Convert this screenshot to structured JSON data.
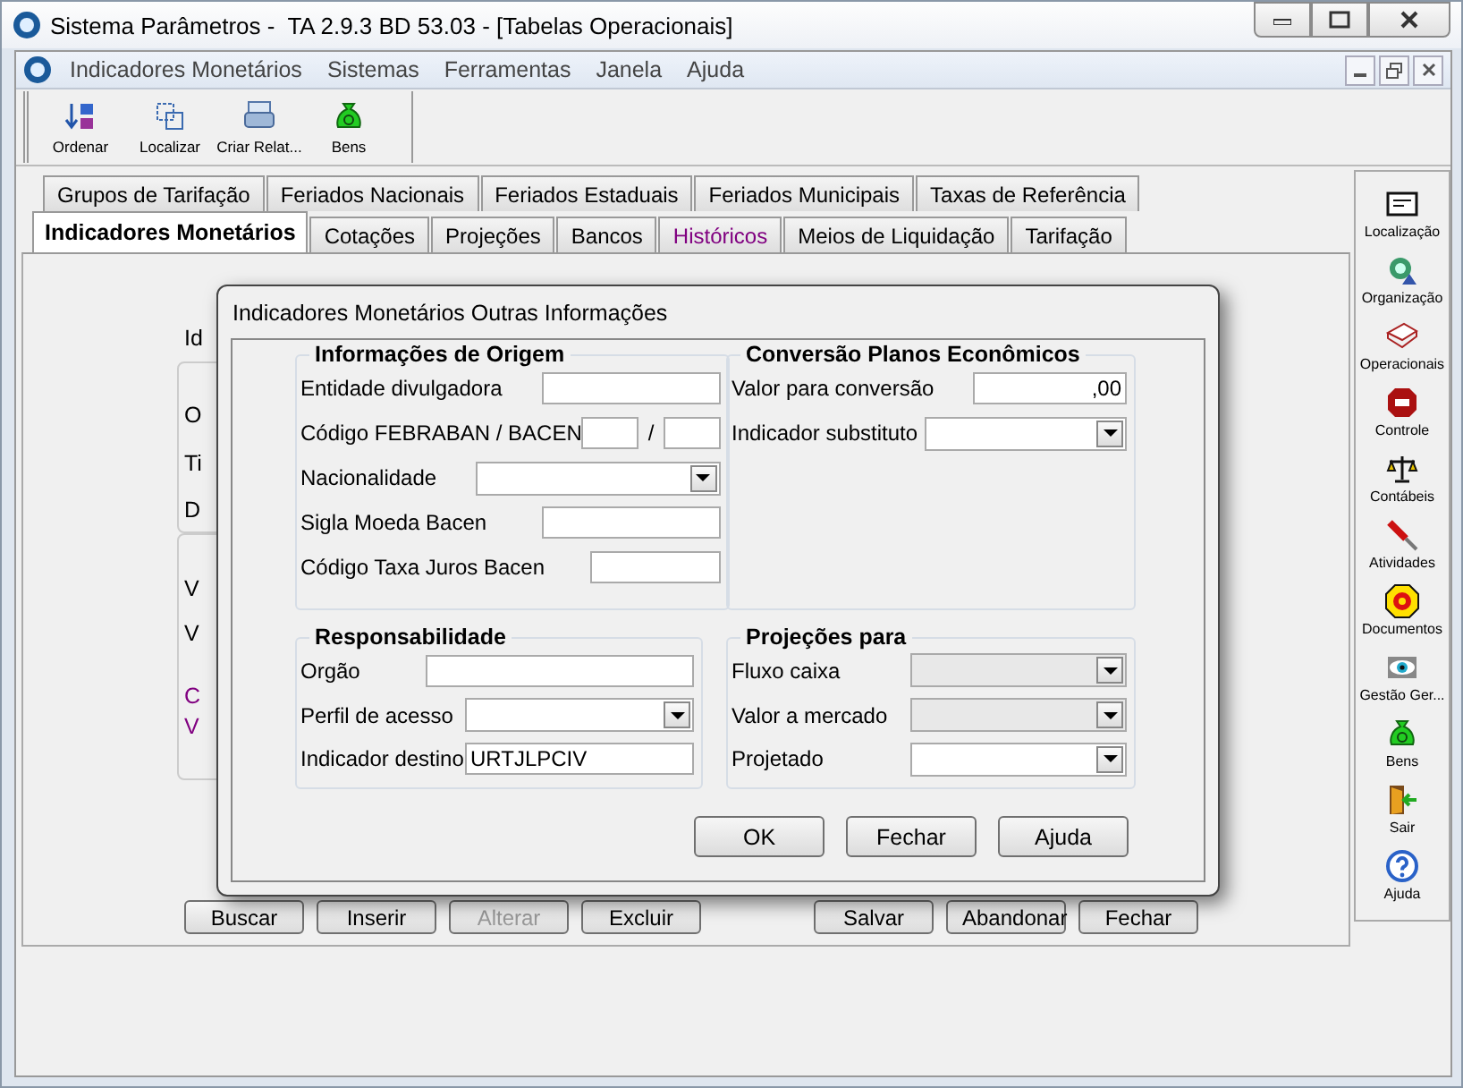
{
  "window": {
    "title": "Sistema Parâmetros -  TA 2.9.3 BD 53.03 - [Tabelas Operacionais]"
  },
  "menu": [
    "Indicadores Monetários",
    "Sistemas",
    "Ferramentas",
    "Janela",
    "Ajuda"
  ],
  "toolbar": [
    {
      "label": "Ordenar",
      "kind": "sort"
    },
    {
      "label": "Localizar",
      "kind": "find"
    },
    {
      "label": "Criar Relat...",
      "kind": "report"
    },
    {
      "label": "Bens",
      "kind": "money"
    }
  ],
  "tabs_row_1": [
    {
      "label": "Grupos de Tarifação",
      "selected": false
    },
    {
      "label": "Feriados Nacionais",
      "selected": false
    },
    {
      "label": "Feriados Estaduais",
      "selected": false
    },
    {
      "label": "Feriados Municipais",
      "selected": false
    },
    {
      "label": "Taxas de Referência",
      "selected": false
    }
  ],
  "tabs_row_2": [
    {
      "label": "Indicadores Monetários",
      "selected": true,
      "color": "#000000"
    },
    {
      "label": "Cotações",
      "selected": false,
      "color": "#000000"
    },
    {
      "label": "Projeções",
      "selected": false,
      "color": "#000000"
    },
    {
      "label": "Bancos",
      "selected": false,
      "color": "#000000"
    },
    {
      "label": "Históricos",
      "selected": false,
      "color": "#800080"
    },
    {
      "label": "Meios de Liquidação",
      "selected": false,
      "color": "#000000"
    },
    {
      "label": "Tarifação",
      "selected": false,
      "color": "#000000"
    }
  ],
  "background_labels": [
    {
      "text": "Id",
      "color": "#000000"
    },
    {
      "text": "O",
      "color": "#000000"
    },
    {
      "text": "Ti",
      "color": "#000000"
    },
    {
      "text": "D",
      "color": "#000000"
    },
    {
      "text": "V",
      "color": "#000000"
    },
    {
      "text": "V",
      "color": "#000000"
    },
    {
      "text": "C",
      "color": "#800080"
    },
    {
      "text": "V",
      "color": "#800080"
    }
  ],
  "background_buttons": [
    {
      "label": "Buscar",
      "disabled": false
    },
    {
      "label": "Inserir",
      "disabled": false
    },
    {
      "label": "Alterar",
      "disabled": true
    },
    {
      "label": "Excluir",
      "disabled": false
    },
    {
      "label": "Salvar",
      "disabled": false
    },
    {
      "label": "Abandonar",
      "disabled": false
    },
    {
      "label": "Fechar",
      "disabled": false
    }
  ],
  "dialog": {
    "title": "Indicadores Monetários Outras Informações",
    "groups": [
      {
        "title": "Informações de Origem",
        "fields": [
          {
            "label": "Entidade divulgadora",
            "kind": "text",
            "disabled": false
          },
          {
            "label": "Código FEBRABAN / BACEN",
            "kind": "pair",
            "separator": "/",
            "disabled": false
          },
          {
            "label": "Nacionalidade",
            "kind": "combo",
            "disabled": false
          },
          {
            "label": "Sigla Moeda Bacen",
            "kind": "text",
            "disabled": false
          },
          {
            "label": "Código Taxa Juros Bacen",
            "kind": "text",
            "disabled": false
          }
        ]
      },
      {
        "title": "Conversão Planos Econômicos",
        "fields": [
          {
            "label": "Valor para conversão",
            "kind": "number",
            "value": ",00",
            "disabled": false
          },
          {
            "label": "Indicador substituto",
            "kind": "combo",
            "disabled": false
          }
        ]
      },
      {
        "title": "Responsabilidade",
        "fields": [
          {
            "label": "Orgão",
            "kind": "text",
            "disabled": false
          },
          {
            "label": "Perfil de acesso",
            "kind": "combo",
            "disabled": false
          },
          {
            "label": "Indicador destino",
            "kind": "text",
            "value": "URTJLPCIV",
            "disabled": false
          }
        ]
      },
      {
        "title": "Projeções para",
        "fields": [
          {
            "label": "Fluxo caixa",
            "kind": "combo",
            "disabled": true
          },
          {
            "label": "Valor a mercado",
            "kind": "combo",
            "disabled": true
          },
          {
            "label": "Projetado",
            "kind": "combo",
            "disabled": false
          }
        ]
      }
    ],
    "buttons": [
      "OK",
      "Fechar",
      "Ajuda"
    ]
  },
  "sidebar": [
    {
      "label": "Localização",
      "kind": "card"
    },
    {
      "label": "Organização",
      "kind": "refresh"
    },
    {
      "label": "Operacionais",
      "kind": "book"
    },
    {
      "label": "Controle",
      "kind": "stop"
    },
    {
      "label": "Contábeis",
      "kind": "scale"
    },
    {
      "label": "Atividades",
      "kind": "screwdriver"
    },
    {
      "label": "Documentos",
      "kind": "target"
    },
    {
      "label": "Gestão Ger...",
      "kind": "eye"
    },
    {
      "label": "Bens",
      "kind": "money"
    },
    {
      "label": "Sair",
      "kind": "exit"
    },
    {
      "label": "Ajuda",
      "kind": "help"
    }
  ]
}
